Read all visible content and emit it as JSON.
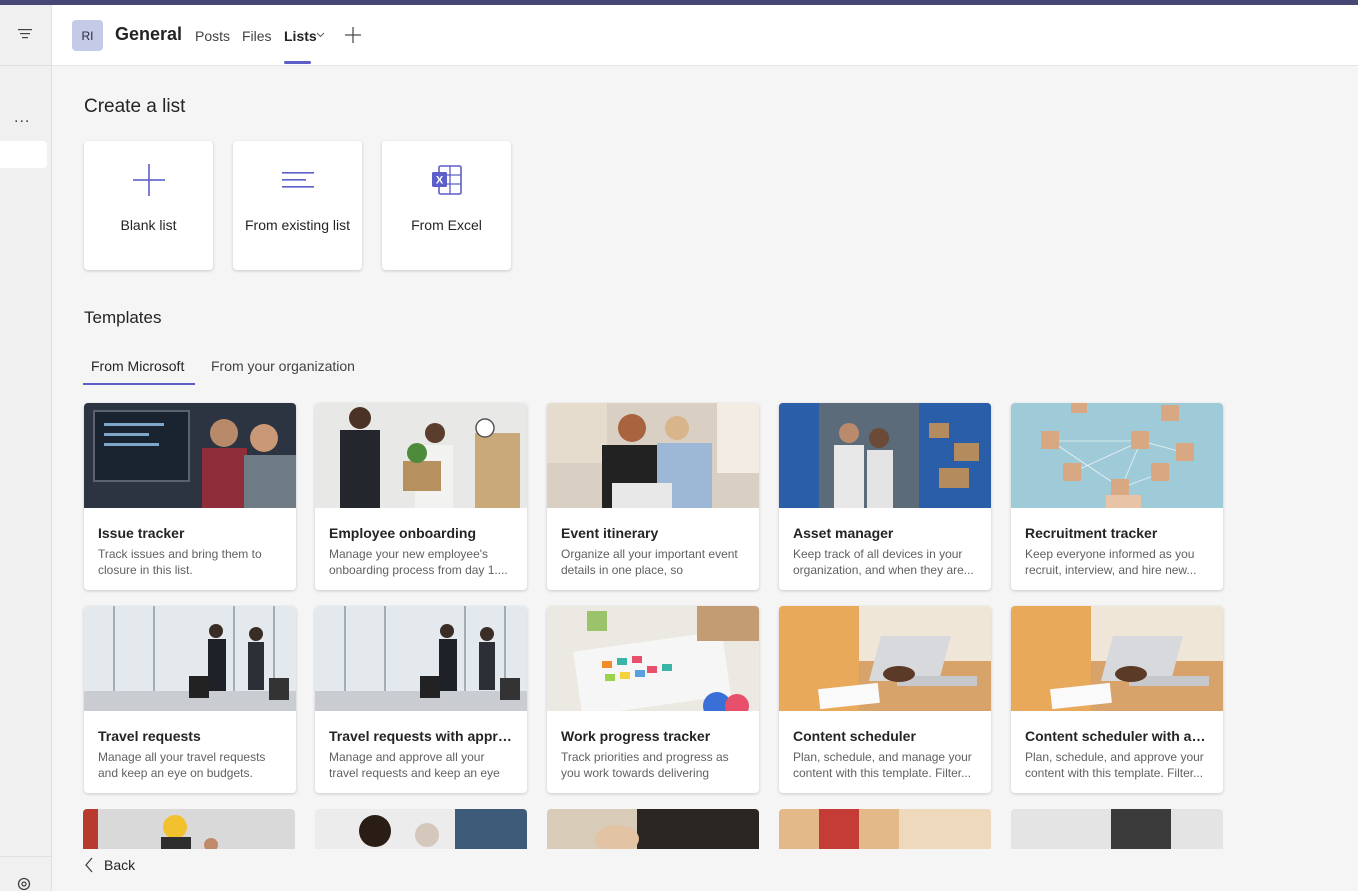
{
  "header": {
    "avatar_initials": "RI",
    "channel_title": "General",
    "tabs": [
      "Posts",
      "Files",
      "Lists"
    ],
    "active_tab": "Lists"
  },
  "rail": {
    "more_label": "..."
  },
  "create": {
    "title": "Create a list",
    "options": [
      {
        "label": "Blank list",
        "icon": "plus-icon"
      },
      {
        "label": "From existing list",
        "icon": "lines-icon"
      },
      {
        "label": "From Excel",
        "icon": "excel-icon"
      }
    ]
  },
  "templates": {
    "title": "Templates",
    "tabs": [
      "From Microsoft",
      "From your organization"
    ],
    "active_tab": "From Microsoft",
    "items": [
      {
        "title": "Issue tracker",
        "desc": "Track issues and bring them to closure in this list."
      },
      {
        "title": "Employee onboarding",
        "desc": "Manage your new employee's onboarding process from day 1...."
      },
      {
        "title": "Event itinerary",
        "desc": "Organize all your important event details in one place, so everything..."
      },
      {
        "title": "Asset manager",
        "desc": "Keep track of all devices in your organization, and when they are..."
      },
      {
        "title": "Recruitment tracker",
        "desc": "Keep everyone informed as you recruit, interview, and hire new..."
      },
      {
        "title": "Travel requests",
        "desc": "Manage all your travel requests and keep an eye on budgets."
      },
      {
        "title": "Travel requests with approv...",
        "desc": "Manage and approve all your travel requests and keep an eye on..."
      },
      {
        "title": "Work progress tracker",
        "desc": "Track priorities and progress as you work towards delivering products..."
      },
      {
        "title": "Content scheduler",
        "desc": "Plan, schedule, and manage your content with this template. Filter..."
      },
      {
        "title": "Content scheduler with app...",
        "desc": "Plan, schedule, and approve your content with this template. Filter..."
      }
    ]
  },
  "footer": {
    "back_label": "Back"
  },
  "colors": {
    "accent": "#5b5fc7",
    "topbar": "#464775"
  }
}
